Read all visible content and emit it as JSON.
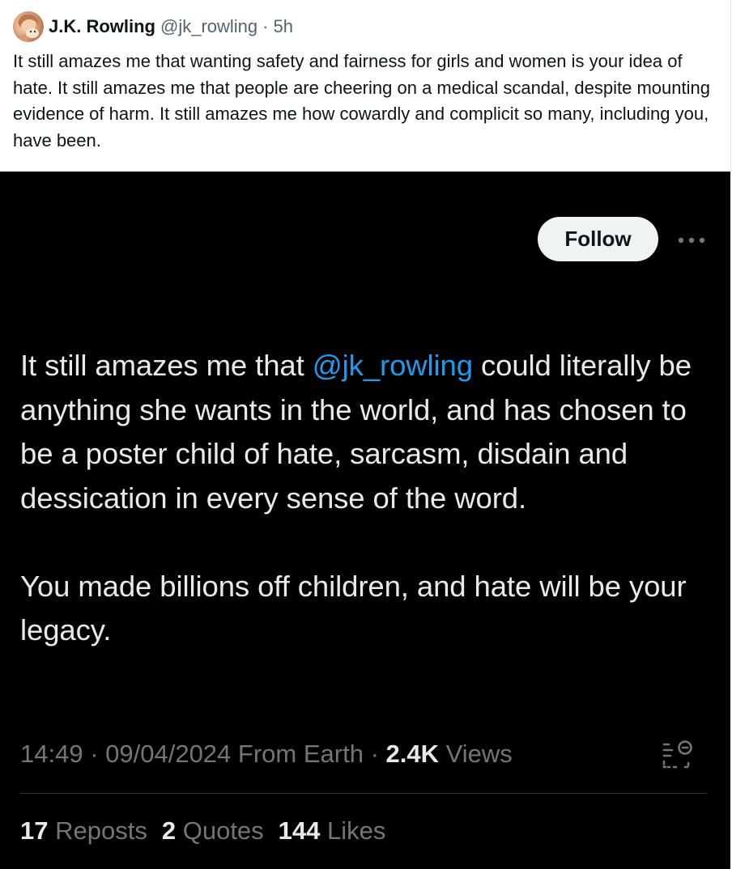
{
  "quoted_tweet": {
    "author_name": "J.K. Rowling",
    "author_handle": "@jk_rowling",
    "separator": "·",
    "time_ago": "5h",
    "text": "It still amazes me that wanting safety and fairness for girls and women is your idea of hate. It still amazes me that people are cheering on a medical scandal, despite mounting evidence of harm. It still amazes me how cowardly and complicit so many, including you, have been."
  },
  "screenshot": {
    "follow_label": "Follow",
    "more_icon": "more-horizontal-icon",
    "body": {
      "p1_before": "It still amazes me that ",
      "mention": "@jk_rowling",
      "p1_after": " could literally be anything she wants in the world, and has chosen to be a poster child of hate, sarcasm, disdain and dessication in every sense of the word.",
      "p2": "You made billions off children, and hate will be your legacy."
    },
    "meta": {
      "time": "14:49",
      "dot1": " · ",
      "date": "09/04/2024",
      "source": " From Earth",
      "dot2": " · ",
      "views_count": "2.4K",
      "views_label": " Views"
    },
    "stats_icon": "post-analytics-icon",
    "counts": {
      "reposts_count": "17",
      "reposts_label": "Reposts",
      "quotes_count": "2",
      "quotes_label": "Quotes",
      "likes_count": "144",
      "likes_label": "Likes"
    }
  },
  "colors": {
    "link_blue": "#1d9bf0",
    "dark_bg": "#000000",
    "dark_text": "#e7e9ea",
    "muted": "#71767b"
  }
}
